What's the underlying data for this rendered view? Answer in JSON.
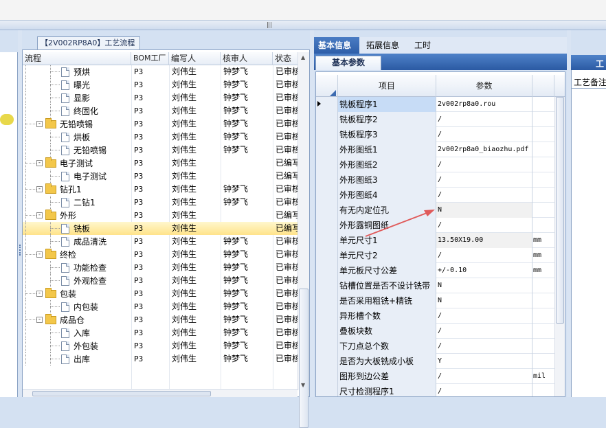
{
  "tree_panel": {
    "tab_label": "【2V002RP8A0】工艺流程",
    "columns": [
      "流程",
      "BOM工厂",
      "编写人",
      "核审人",
      "状态"
    ],
    "rows": [
      {
        "indent": 2,
        "kind": "doc",
        "name": "预烘",
        "bom": "P3",
        "author": "刘伟生",
        "reviewer": "钟梦飞",
        "status": "已审核",
        "selected": false
      },
      {
        "indent": 2,
        "kind": "doc",
        "name": "曝光",
        "bom": "P3",
        "author": "刘伟生",
        "reviewer": "钟梦飞",
        "status": "已审核",
        "selected": false
      },
      {
        "indent": 2,
        "kind": "doc",
        "name": "显影",
        "bom": "P3",
        "author": "刘伟生",
        "reviewer": "钟梦飞",
        "status": "已审核",
        "selected": false
      },
      {
        "indent": 2,
        "kind": "doc",
        "name": "终固化",
        "bom": "P3",
        "author": "刘伟生",
        "reviewer": "钟梦飞",
        "status": "已审核",
        "selected": false
      },
      {
        "indent": 1,
        "kind": "folder",
        "name": "无铅喷锡",
        "bom": "P3",
        "author": "刘伟生",
        "reviewer": "钟梦飞",
        "status": "已审核",
        "selected": false
      },
      {
        "indent": 2,
        "kind": "doc",
        "name": "烘板",
        "bom": "P3",
        "author": "刘伟生",
        "reviewer": "钟梦飞",
        "status": "已审核",
        "selected": false
      },
      {
        "indent": 2,
        "kind": "doc",
        "name": "无铅喷锡",
        "bom": "P3",
        "author": "刘伟生",
        "reviewer": "钟梦飞",
        "status": "已审核",
        "selected": false
      },
      {
        "indent": 1,
        "kind": "folder",
        "name": "电子测试",
        "bom": "P3",
        "author": "刘伟生",
        "reviewer": "",
        "status": "已编写",
        "selected": false
      },
      {
        "indent": 2,
        "kind": "doc",
        "name": "电子测试",
        "bom": "P3",
        "author": "刘伟生",
        "reviewer": "",
        "status": "已编写",
        "selected": false
      },
      {
        "indent": 1,
        "kind": "folder",
        "name": "钻孔1",
        "bom": "P3",
        "author": "刘伟生",
        "reviewer": "钟梦飞",
        "status": "已审核",
        "selected": false
      },
      {
        "indent": 2,
        "kind": "doc",
        "name": "二钻1",
        "bom": "P3",
        "author": "刘伟生",
        "reviewer": "钟梦飞",
        "status": "已审核",
        "selected": false
      },
      {
        "indent": 1,
        "kind": "folder",
        "name": "外形",
        "bom": "P3",
        "author": "刘伟生",
        "reviewer": "",
        "status": "已编写",
        "selected": false
      },
      {
        "indent": 2,
        "kind": "doc",
        "name": "铣板",
        "bom": "P3",
        "author": "刘伟生",
        "reviewer": "",
        "status": "已编写",
        "selected": true
      },
      {
        "indent": 2,
        "kind": "doc",
        "name": "成品清洗",
        "bom": "P3",
        "author": "刘伟生",
        "reviewer": "钟梦飞",
        "status": "已审核",
        "selected": false
      },
      {
        "indent": 1,
        "kind": "folder",
        "name": "终检",
        "bom": "P3",
        "author": "刘伟生",
        "reviewer": "钟梦飞",
        "status": "已审核",
        "selected": false
      },
      {
        "indent": 2,
        "kind": "doc",
        "name": "功能检查",
        "bom": "P3",
        "author": "刘伟生",
        "reviewer": "钟梦飞",
        "status": "已审核",
        "selected": false
      },
      {
        "indent": 2,
        "kind": "doc",
        "name": "外观检查",
        "bom": "P3",
        "author": "刘伟生",
        "reviewer": "钟梦飞",
        "status": "已审核",
        "selected": false
      },
      {
        "indent": 1,
        "kind": "folder",
        "name": "包装",
        "bom": "P3",
        "author": "刘伟生",
        "reviewer": "钟梦飞",
        "status": "已审核",
        "selected": false
      },
      {
        "indent": 2,
        "kind": "doc",
        "name": "内包装",
        "bom": "P3",
        "author": "刘伟生",
        "reviewer": "钟梦飞",
        "status": "已审核",
        "selected": false
      },
      {
        "indent": 1,
        "kind": "folder",
        "name": "成品仓",
        "bom": "P3",
        "author": "刘伟生",
        "reviewer": "钟梦飞",
        "status": "已审核",
        "selected": false
      },
      {
        "indent": 2,
        "kind": "doc",
        "name": "入库",
        "bom": "P3",
        "author": "刘伟生",
        "reviewer": "钟梦飞",
        "status": "已审核",
        "selected": false
      },
      {
        "indent": 2,
        "kind": "doc",
        "name": "外包装",
        "bom": "P3",
        "author": "刘伟生",
        "reviewer": "钟梦飞",
        "status": "已审核",
        "selected": false
      },
      {
        "indent": 2,
        "kind": "doc",
        "name": "出库",
        "bom": "P3",
        "author": "刘伟生",
        "reviewer": "钟梦飞",
        "status": "已审核",
        "selected": false
      }
    ]
  },
  "info_panel": {
    "tabs": [
      "基本信息",
      "拓展信息",
      "工时"
    ],
    "active_tab": "基本信息",
    "sub_tab": "基本参数",
    "columns": [
      "项目",
      "参数"
    ],
    "rows": [
      {
        "name": "铣板程序1",
        "value": "2v002rp8a0.rou",
        "unit": "",
        "current": true,
        "gray": false
      },
      {
        "name": "铣板程序2",
        "value": "/",
        "unit": "",
        "current": false,
        "gray": false
      },
      {
        "name": "铣板程序3",
        "value": "/",
        "unit": "",
        "current": false,
        "gray": false
      },
      {
        "name": "外形图纸1",
        "value": "2v002rp8a0_biaozhu.pdf",
        "unit": "",
        "current": false,
        "gray": false
      },
      {
        "name": "外形图纸2",
        "value": "/",
        "unit": "",
        "current": false,
        "gray": false
      },
      {
        "name": "外形图纸3",
        "value": "/",
        "unit": "",
        "current": false,
        "gray": false
      },
      {
        "name": "外形图纸4",
        "value": "/",
        "unit": "",
        "current": false,
        "gray": false
      },
      {
        "name": "有无内定位孔",
        "value": "N",
        "unit": "",
        "current": false,
        "gray": true
      },
      {
        "name": "外形露铜图纸",
        "value": "/",
        "unit": "",
        "current": false,
        "gray": false
      },
      {
        "name": "单元尺寸1",
        "value": "13.50X19.00",
        "unit": "mm",
        "current": false,
        "gray": true
      },
      {
        "name": "单元尺寸2",
        "value": "/",
        "unit": "mm",
        "current": false,
        "gray": false
      },
      {
        "name": "单元板尺寸公差",
        "value": "+/-0.10",
        "unit": "mm",
        "current": false,
        "gray": false
      },
      {
        "name": "钻槽位置是否不设计铣带",
        "value": "N",
        "unit": "",
        "current": false,
        "gray": false
      },
      {
        "name": "是否采用粗铣+精铣",
        "value": "N",
        "unit": "",
        "current": false,
        "gray": false
      },
      {
        "name": "异形槽个数",
        "value": "/",
        "unit": "",
        "current": false,
        "gray": false
      },
      {
        "name": "叠板块数",
        "value": "/",
        "unit": "",
        "current": false,
        "gray": false
      },
      {
        "name": "下刀点总个数",
        "value": "/",
        "unit": "",
        "current": false,
        "gray": false
      },
      {
        "name": "是否为大板铣成小板",
        "value": "Y",
        "unit": "",
        "current": false,
        "gray": false
      },
      {
        "name": "图形到边公差",
        "value": "/",
        "unit": "mil",
        "current": false,
        "gray": false
      },
      {
        "name": "尺寸检测程序1",
        "value": "/",
        "unit": "",
        "current": false,
        "gray": false
      }
    ]
  },
  "right_panel": {
    "tab_label": "工",
    "field_label": "工艺备注"
  },
  "colors": {
    "accent": "#2e5ea8",
    "annotation_arrow": "#e05a5a",
    "selected_row": "#ffe38a"
  }
}
